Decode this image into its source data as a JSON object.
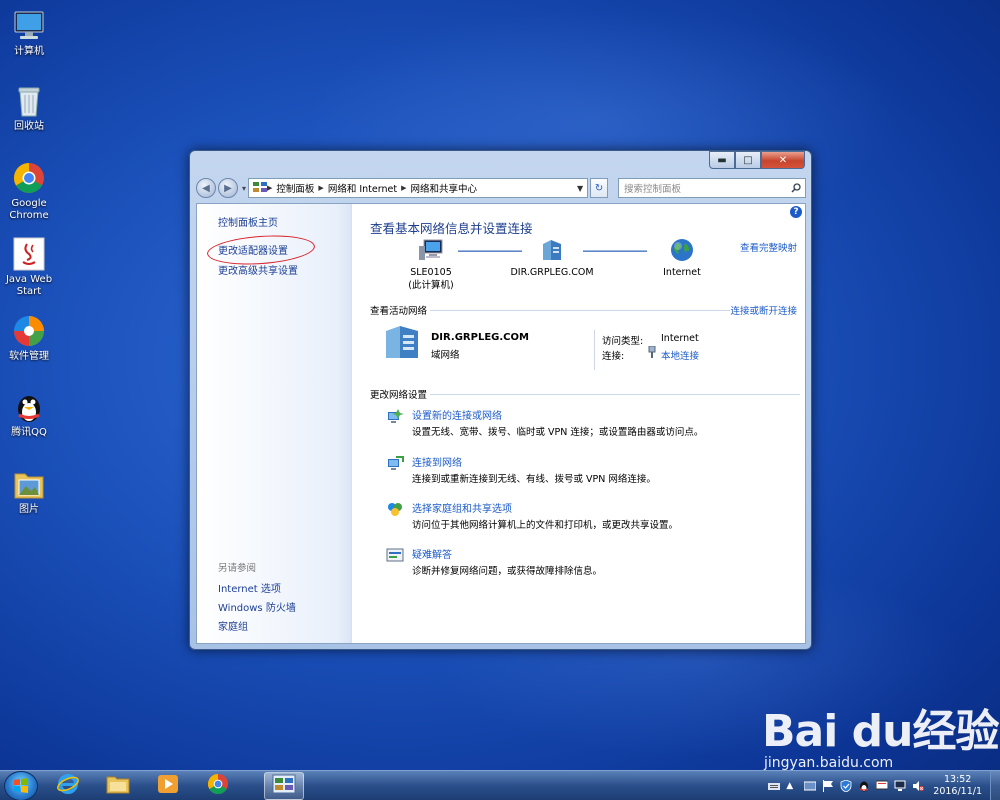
{
  "desktop": {
    "icons": [
      {
        "label": "计算机"
      },
      {
        "label": "回收站"
      },
      {
        "label": "Google\nChrome"
      },
      {
        "label": "Java Web\nStart"
      },
      {
        "label": "软件管理"
      },
      {
        "label": "腾讯QQ"
      },
      {
        "label": "图片"
      }
    ]
  },
  "window": {
    "controls": {
      "minimize": "▬",
      "maximize": "□",
      "close": "✕"
    },
    "address": {
      "crumbs": [
        "控制面板",
        "网络和 Internet",
        "网络和共享中心"
      ]
    },
    "search": {
      "placeholder": "搜索控制面板"
    },
    "left_pane": {
      "home": "控制面板主页",
      "links": [
        "更改适配器设置",
        "更改高级共享设置"
      ],
      "see_also_title": "另请参阅",
      "see_also": [
        "Internet 选项",
        "Windows 防火墙",
        "家庭组"
      ]
    },
    "main": {
      "help": "?",
      "title": "查看基本网络信息并设置连接",
      "view_full_map": "查看完整映射",
      "nodes": [
        {
          "name": "SLE0105",
          "sub": "(此计算机)"
        },
        {
          "name": "DIR.GRPLEG.COM",
          "sub": ""
        },
        {
          "name": "Internet",
          "sub": ""
        }
      ],
      "active_section": "查看活动网络",
      "connect_disconnect": "连接或断开连接",
      "active_network": {
        "name": "DIR.GRPLEG.COM",
        "type": "域网络",
        "access_type_label": "访问类型:",
        "access_type_value": "Internet",
        "connection_label": "连接:",
        "connection_value": "本地连接"
      },
      "change_section": "更改网络设置",
      "tasks": [
        {
          "title": "设置新的连接或网络",
          "desc": "设置无线、宽带、拨号、临时或 VPN 连接；或设置路由器或访问点。"
        },
        {
          "title": "连接到网络",
          "desc": "连接到或重新连接到无线、有线、拨号或 VPN 网络连接。"
        },
        {
          "title": "选择家庭组和共享选项",
          "desc": "访问位于其他网络计算机上的文件和打印机，或更改共享设置。"
        },
        {
          "title": "疑难解答",
          "desc": "诊断并修复网络问题，或获得故障排除信息。"
        }
      ]
    }
  },
  "taskbar": {
    "clock_time": "13:52",
    "clock_date": "2016/11/1"
  },
  "watermark": {
    "brand": "Bai du经验",
    "url": "jingyan.baidu.com"
  },
  "colors": {
    "link": "#1c5bc8",
    "title": "#1e3f8f",
    "annotation": "#d8202a"
  }
}
